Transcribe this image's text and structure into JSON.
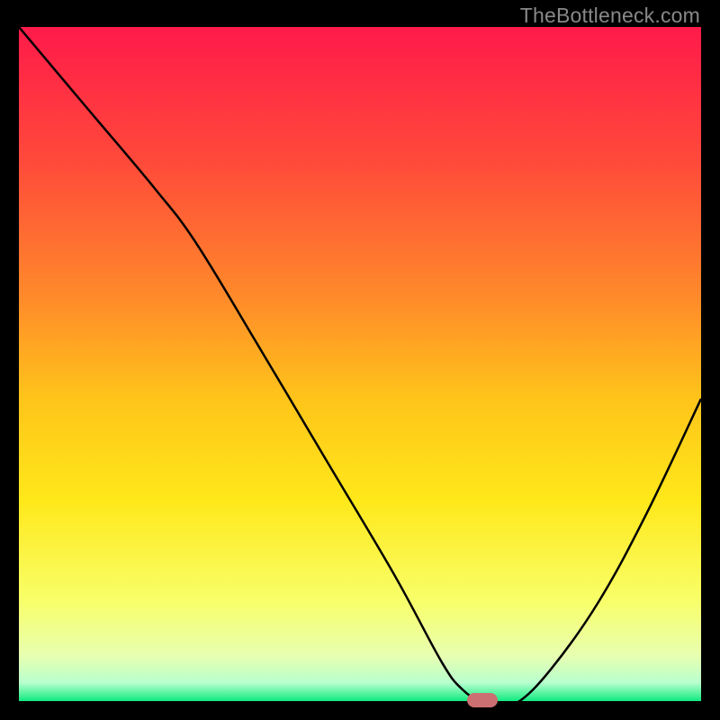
{
  "watermark": "TheBottleneck.com",
  "chart_data": {
    "type": "line",
    "title": "",
    "xlabel": "",
    "ylabel": "",
    "xlim": [
      0,
      100
    ],
    "ylim": [
      0,
      100
    ],
    "grid": false,
    "series": [
      {
        "name": "bottleneck-curve",
        "x": [
          0,
          10,
          20,
          26,
          35,
          45,
          55,
          62,
          65,
          68,
          70,
          73,
          78,
          85,
          92,
          100
        ],
        "y": [
          100,
          88,
          76,
          68,
          53,
          36,
          19,
          6,
          2,
          0,
          0,
          0,
          5,
          15,
          28,
          45
        ]
      }
    ],
    "marker": {
      "x": 68,
      "y": 0,
      "color": "#cc6f73"
    },
    "gradient_stops": [
      {
        "offset": 0.0,
        "color": "#ff1a4a"
      },
      {
        "offset": 0.2,
        "color": "#ff4a3a"
      },
      {
        "offset": 0.4,
        "color": "#ff8a2a"
      },
      {
        "offset": 0.55,
        "color": "#ffc41a"
      },
      {
        "offset": 0.7,
        "color": "#ffe81a"
      },
      {
        "offset": 0.85,
        "color": "#f8ff6a"
      },
      {
        "offset": 0.93,
        "color": "#e8ffb0"
      },
      {
        "offset": 0.97,
        "color": "#b8ffce"
      },
      {
        "offset": 1.0,
        "color": "#00e878"
      }
    ]
  }
}
